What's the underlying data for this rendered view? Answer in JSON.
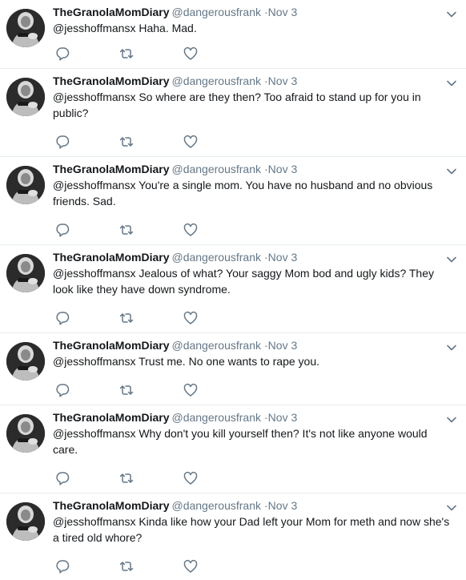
{
  "colors": {
    "text": "#14171a",
    "secondary": "#657786",
    "border": "#e6ecf0",
    "icon": "#657786"
  },
  "icons": {
    "reply": "reply-icon",
    "retweet": "retweet-icon",
    "like": "like-icon",
    "more": "chevron-down-icon"
  },
  "tweets": [
    {
      "display_name": "TheGranolaMomDiary",
      "screen_name": "@dangerousfrank",
      "separator": "·",
      "date": "Nov 3",
      "mention": "@jesshoffmansx",
      "text": "Haha. Mad."
    },
    {
      "display_name": "TheGranolaMomDiary",
      "screen_name": "@dangerousfrank",
      "separator": "·",
      "date": "Nov 3",
      "mention": "@jesshoffmansx",
      "text": "So where are they then? Too afraid to stand up for you in public?"
    },
    {
      "display_name": "TheGranolaMomDiary",
      "screen_name": "@dangerousfrank",
      "separator": "·",
      "date": "Nov 3",
      "mention": "@jesshoffmansx",
      "text": "You're a single mom. You have no husband and no obvious friends. Sad."
    },
    {
      "display_name": "TheGranolaMomDiary",
      "screen_name": "@dangerousfrank",
      "separator": "·",
      "date": "Nov 3",
      "mention": "@jesshoffmansx",
      "text": "Jealous of what? Your saggy Mom bod and ugly kids? They look like they have down syndrome."
    },
    {
      "display_name": "TheGranolaMomDiary",
      "screen_name": "@dangerousfrank",
      "separator": "·",
      "date": "Nov 3",
      "mention": "@jesshoffmansx",
      "text": "Trust me. No one wants to rape you."
    },
    {
      "display_name": "TheGranolaMomDiary",
      "screen_name": "@dangerousfrank",
      "separator": "·",
      "date": "Nov 3",
      "mention": "@jesshoffmansx",
      "text": "Why don't you kill yourself then? It's not like anyone would care."
    },
    {
      "display_name": "TheGranolaMomDiary",
      "screen_name": "@dangerousfrank",
      "separator": "·",
      "date": "Nov 3",
      "mention": "@jesshoffmansx",
      "text": "Kinda like how your Dad left your Mom for meth and now she's a tired old whore?"
    }
  ]
}
